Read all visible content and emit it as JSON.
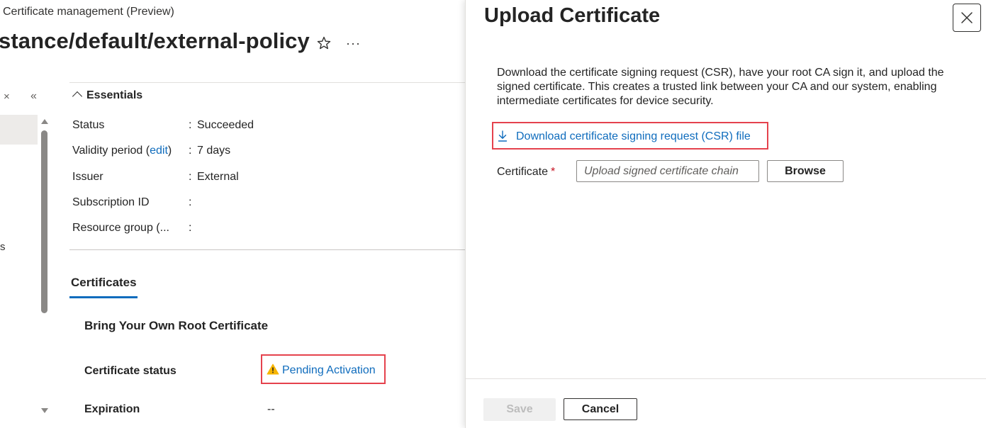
{
  "background": {
    "breadcrumb": "Certificate management (Preview)",
    "title": "stance/default/external-policy",
    "more_label": "···",
    "sidebar": {
      "close_label": "×",
      "collapse_label": "«",
      "fragment_text": "s"
    },
    "essentials": {
      "heading": "Essentials",
      "rows": [
        {
          "label": "Status",
          "value": "Succeeded"
        },
        {
          "label_before": "Validity period (",
          "label_link": "edit",
          "label_after": ")",
          "value": "7 days"
        },
        {
          "label": "Issuer",
          "value": "External"
        },
        {
          "label": "Subscription ID",
          "value": ""
        },
        {
          "label": "Resource group (...",
          "value": ""
        }
      ],
      "separator": ":"
    },
    "tab_label": "Certificates",
    "section_heading": "Bring Your Own Root Certificate",
    "certificate_status": {
      "label": "Certificate status",
      "value": "Pending Activation"
    },
    "expiration": {
      "label": "Expiration",
      "value": "--"
    }
  },
  "panel": {
    "title": "Upload Certificate",
    "description": "Download the certificate signing request (CSR), have your root CA sign it, and upload the signed certificate. This creates a trusted link between your CA and our system, enabling intermediate certificates for device security.",
    "download_link": "Download certificate signing request (CSR) file",
    "certificate_label": "Certificate",
    "required_mark": "*",
    "certificate_input": {
      "value": "",
      "placeholder": "Upload signed certificate chain"
    },
    "browse_label": "Browse",
    "save_label": "Save",
    "cancel_label": "Cancel"
  },
  "colors": {
    "link": "#0f6cbd",
    "highlight_border": "#e5424d",
    "warning": "#f7b500",
    "required": "#c50f1f"
  },
  "icons": [
    "star-icon",
    "more-icon",
    "close-icon",
    "collapse-icon",
    "chevron-up-icon",
    "warning-icon",
    "download-icon"
  ]
}
